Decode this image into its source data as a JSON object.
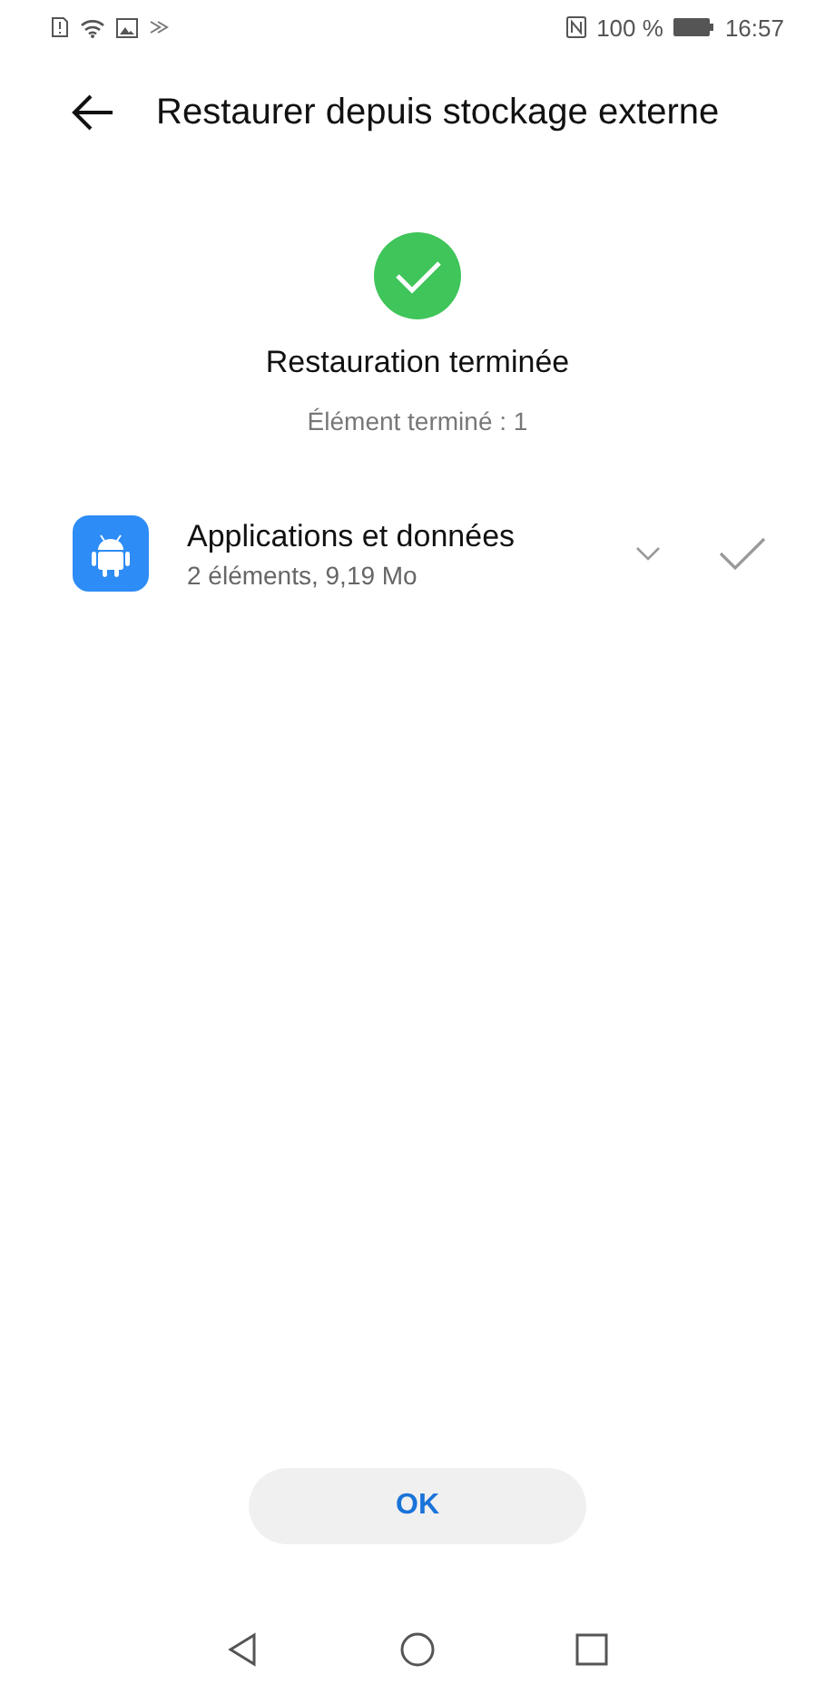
{
  "status_bar": {
    "battery_text": "100 %",
    "time": "16:57"
  },
  "header": {
    "title": "Restaurer depuis stockage externe"
  },
  "result": {
    "done": true,
    "title": "Restauration terminée",
    "subtitle": "Élément terminé : 1"
  },
  "items": [
    {
      "title": "Applications et données",
      "detail": "2 éléments, 9,19 Mo",
      "expanded": false,
      "done": true
    }
  ],
  "ok_button": "OK"
}
